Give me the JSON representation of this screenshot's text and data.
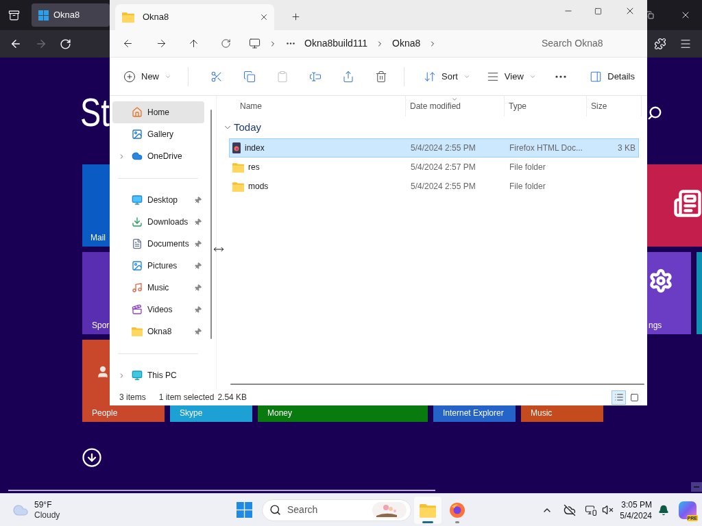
{
  "browser": {
    "tab": {
      "title": "Okna8"
    },
    "forward_disabled": true
  },
  "start": {
    "title": "St",
    "tiles": [
      {
        "label": "Mail",
        "color": "#0a5bc4"
      },
      {
        "color": "#c41e4c"
      },
      {
        "label": "Spor",
        "color": "#5a2eb0"
      },
      {
        "label": "ngs",
        "color": "#6a3dc4"
      },
      {
        "color": "#0e92b4"
      },
      {
        "label": "People",
        "color": "#c9472a"
      },
      {
        "label": "Skype",
        "color": "#1da0d4"
      },
      {
        "label": "Money",
        "color": "#087a0e"
      },
      {
        "label": "Internet Explorer",
        "color": "#2463c8"
      },
      {
        "label": "Music",
        "color": "#c44b1e"
      }
    ]
  },
  "explorer": {
    "tab": {
      "title": "Okna8"
    },
    "address": {
      "segments": [
        "Okna8build111",
        "Okna8"
      ]
    },
    "search": {
      "placeholder": "Search Okna8"
    },
    "toolbar": [
      {
        "kind": "new",
        "label": "New",
        "disabled": false
      },
      {
        "kind": "cut",
        "disabled": false
      },
      {
        "kind": "copy",
        "disabled": false
      },
      {
        "kind": "paste",
        "disabled": true
      },
      {
        "kind": "rename",
        "disabled": false
      },
      {
        "kind": "share",
        "disabled": false
      },
      {
        "kind": "delete",
        "disabled": false
      },
      {
        "kind": "sort",
        "label": "Sort",
        "disabled": false
      },
      {
        "kind": "view",
        "label": "View",
        "disabled": false
      },
      {
        "kind": "more",
        "disabled": false
      },
      {
        "kind": "details",
        "label": "Details",
        "disabled": false
      }
    ],
    "sidebar": {
      "sections": [
        {
          "items": [
            {
              "label": "Home",
              "kind": "home",
              "selected": true,
              "pinned": false,
              "expandable": false
            },
            {
              "label": "Gallery",
              "kind": "gallery",
              "selected": false,
              "pinned": false,
              "expandable": false
            },
            {
              "label": "OneDrive",
              "kind": "cloud",
              "selected": false,
              "pinned": false,
              "expandable": true
            }
          ]
        },
        {
          "items": [
            {
              "label": "Desktop",
              "kind": "desktop",
              "selected": false,
              "pinned": true,
              "expandable": false
            },
            {
              "label": "Downloads",
              "kind": "downloads",
              "selected": false,
              "pinned": true,
              "expandable": false
            },
            {
              "label": "Documents",
              "kind": "documents",
              "selected": false,
              "pinned": true,
              "expandable": false
            },
            {
              "label": "Pictures",
              "kind": "pictures",
              "selected": false,
              "pinned": true,
              "expandable": false
            },
            {
              "label": "Music",
              "kind": "music",
              "selected": false,
              "pinned": true,
              "expandable": false
            },
            {
              "label": "Videos",
              "kind": "videos",
              "selected": false,
              "pinned": true,
              "expandable": false
            },
            {
              "label": "Okna8",
              "kind": "folder",
              "selected": false,
              "pinned": true,
              "expandable": false
            }
          ]
        },
        {
          "items": [
            {
              "label": "This PC",
              "kind": "pc",
              "selected": false,
              "pinned": false,
              "expandable": true
            }
          ]
        }
      ]
    },
    "columns": [
      "Name",
      "Date modified",
      "Type",
      "Size"
    ],
    "groups": [
      {
        "label": "Today",
        "expanded": true,
        "rows": [
          {
            "kind": "html",
            "name": "index",
            "date": "5/4/2024 2:55 PM",
            "type": "Firefox HTML Doc...",
            "size": "3 KB",
            "selected": true
          },
          {
            "kind": "folder",
            "name": "res",
            "date": "5/4/2024 2:57 PM",
            "type": "File folder",
            "selected": false
          },
          {
            "kind": "folder",
            "name": "mods",
            "date": "5/4/2024 2:55 PM",
            "type": "File folder",
            "selected": false
          }
        ]
      }
    ],
    "status": {
      "count": "3 items",
      "selection": "1 item selected",
      "size": "2.54 KB"
    },
    "views": [
      {
        "kind": "details",
        "selected": true
      },
      {
        "kind": "tiles",
        "selected": false
      }
    ]
  },
  "taskbar": {
    "weather": {
      "temp": "59°F",
      "condition": "Cloudy"
    },
    "search": {
      "placeholder": "Search"
    },
    "apps": [
      {
        "kind": "explorer",
        "active": true
      },
      {
        "kind": "firefox",
        "active": false
      }
    ],
    "clock": {
      "time": "3:05 PM",
      "date": "5/4/2024"
    },
    "copilot_badge": "PRE"
  }
}
